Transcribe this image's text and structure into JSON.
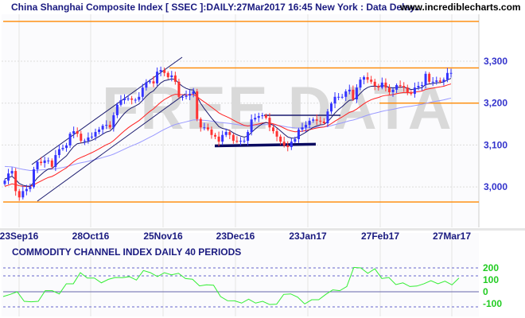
{
  "header": {
    "title": "China Shanghai Composite Index [ SSEC ]:DAILY:27Mar2017 16:45 New York : Data Delay..",
    "site": "www.incrediblecharts.com",
    "watermark": "FREE DATA"
  },
  "colors": {
    "up": "#3333ff",
    "down": "#ff3333",
    "ma_short": "#1a1a6e",
    "ma_long": "#ff2020",
    "ma_trend": "#9999ff",
    "orange": "#ff8800",
    "cci": "#33ee33"
  },
  "chart_data": [
    {
      "type": "candlestick",
      "title": "China Shanghai Composite Index [ SSEC ]",
      "ylim": [
        2910,
        3420
      ],
      "yticks": [
        {
          "v": 3300,
          "label": "3,300"
        },
        {
          "v": 3200,
          "label": "3,200"
        },
        {
          "v": 3100,
          "label": "3,100"
        },
        {
          "v": 3000,
          "label": "3,000"
        }
      ],
      "xticks": [
        "23Sep16",
        "28Oct16",
        "25Nov16",
        "23Dec16",
        "23Jan17",
        "27Feb17",
        "27Mar17"
      ],
      "closes": [
        3015,
        3032,
        3038,
        2990,
        2975,
        2990,
        2995,
        3000,
        3042,
        3060,
        3057,
        3063,
        3063,
        3048,
        3076,
        3090,
        3093,
        3099,
        3127,
        3133,
        3127,
        3110,
        3110,
        3118,
        3120,
        3131,
        3137,
        3146,
        3148,
        3142,
        3171,
        3196,
        3207,
        3211,
        3211,
        3208,
        3208,
        3215,
        3237,
        3250,
        3252,
        3247,
        3275,
        3279,
        3272,
        3262,
        3266,
        3251,
        3215,
        3215,
        3218,
        3222,
        3228,
        3162,
        3142,
        3142,
        3137,
        3124,
        3120,
        3108,
        3124,
        3131,
        3124,
        3110,
        3108,
        3110,
        3110,
        3131,
        3161,
        3165,
        3169,
        3171,
        3165,
        3142,
        3133,
        3120,
        3108,
        3099,
        3095,
        3108,
        3114,
        3137,
        3142,
        3148,
        3158,
        3161,
        3158,
        3156,
        3152,
        3180,
        3199,
        3215,
        3215,
        3215,
        3228,
        3232,
        3209,
        3237,
        3256,
        3262,
        3256,
        3251,
        3241,
        3237,
        3249,
        3237,
        3226,
        3232,
        3243,
        3241,
        3237,
        3226,
        3222,
        3237,
        3241,
        3243,
        3270,
        3251,
        3251,
        3254,
        3251,
        3256,
        3272,
        3272
      ],
      "horizontal_lines": [
        3395,
        3284,
        3200,
        2964
      ],
      "support_line": [
        3098,
        3102
      ],
      "resistance_line": 3171
    },
    {
      "type": "line",
      "title": "COMMODITY CHANNEL INDEX DAILY 40 PERIODS",
      "ylim": [
        -150,
        260
      ],
      "yticks": [
        {
          "v": 200,
          "label": "200"
        },
        {
          "v": 100,
          "label": "100"
        },
        {
          "v": 0,
          "label": "0"
        },
        {
          "v": -100,
          "label": "-100"
        }
      ],
      "values": [
        -40,
        -22,
        0,
        -80,
        -84,
        -80,
        9,
        9,
        -18,
        67,
        67,
        160,
        115,
        115,
        75,
        104,
        120,
        118,
        127,
        98,
        178,
        160,
        127,
        160,
        142,
        155,
        111,
        105,
        49,
        58,
        55,
        -40,
        -75,
        -76,
        -95,
        -62,
        -95,
        -80,
        -107,
        -104,
        -22,
        -18,
        -45,
        -102,
        -67,
        -67,
        -22,
        16,
        9,
        44,
        204,
        200,
        155,
        193,
        111,
        120,
        60,
        75,
        44,
        48,
        67,
        93,
        67,
        89,
        58,
        115
      ]
    }
  ]
}
